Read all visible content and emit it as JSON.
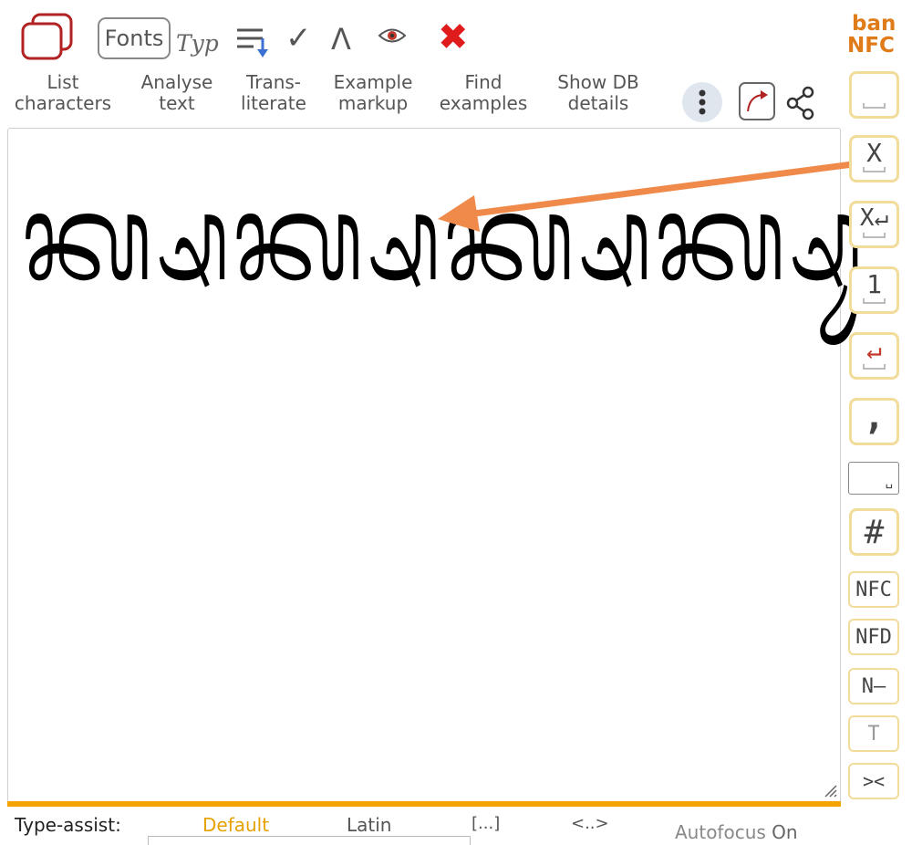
{
  "script_tag": {
    "line1": "ban",
    "line2": "NFC",
    "color": "#e07b1a"
  },
  "toolbar": {
    "icons": {
      "list": "two-squares-icon",
      "fonts": "Fonts",
      "typ": "Typ",
      "analyse": "sort-lines-icon",
      "check": "✓",
      "caret": "Λ",
      "eye": "eye-icon",
      "close": "✖"
    },
    "labels": {
      "list": "List\ncharacters",
      "analyse": "Analyse\ntext",
      "translit": "Trans-\nliterate",
      "example": "Example\nmarkup",
      "find": "Find\nexamples",
      "show_db": "Show DB\ndetails"
    }
  },
  "editor": {
    "text": "ᬓ᭄ᬱᬓ᭄ᬱᬓ᭄ᬱᬓ᭄ᬱᬸ",
    "accent": "#f4a300"
  },
  "side_panel": {
    "x_label": "X",
    "x_return_label": "X↵",
    "one_label": "1",
    "return_label": "↵",
    "comma_label": ",",
    "space_label": "␣",
    "hash_label": "#",
    "nfc_label": "NFC",
    "nfd_label": "NFD",
    "n_minus_label": "N–",
    "t_label": "T",
    "swap_label": "><"
  },
  "bottom_bar": {
    "type_assist_label": "Type-assist:",
    "options": [
      "Default",
      "Latin",
      "[...]",
      "<..>"
    ],
    "active_option": "Default",
    "autofocus_label": "Autofocus",
    "autofocus_state": "On"
  },
  "colors": {
    "arrow": "#f08a4b",
    "active": "#e6a100",
    "red_x": "#e01b1b",
    "list_icon": "#b22222"
  }
}
